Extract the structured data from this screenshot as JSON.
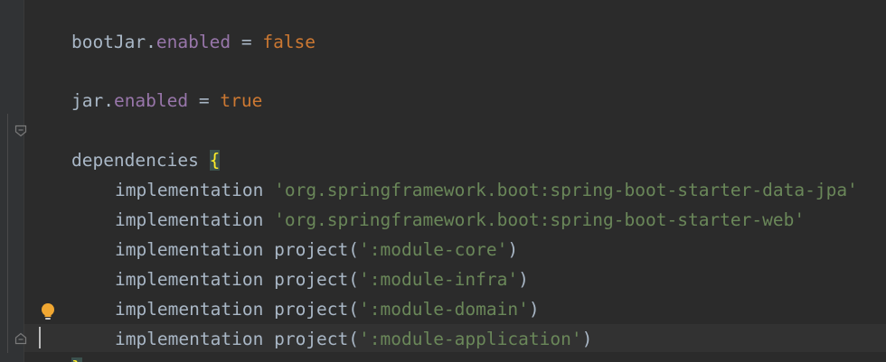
{
  "colors": {
    "background": "#2b2b2b",
    "gutter": "#313335",
    "default_text": "#a9b7c6",
    "property": "#9876aa",
    "keyword_literal": "#cc7832",
    "string": "#6a8759",
    "brace_highlight_bg": "#3b514d",
    "brace_highlight_fg": "#ffef28",
    "current_line": "#323232"
  },
  "lines": {
    "l1": {
      "obj": "bootJar",
      "dot": ".",
      "prop": "enabled",
      "eq": " = ",
      "val": "false"
    },
    "l2": {
      "obj": "jar",
      "dot": ".",
      "prop": "enabled",
      "eq": " = ",
      "val": "true"
    },
    "l3": {
      "keyword": "dependencies",
      "space": " ",
      "open_brace": "{"
    },
    "deps": [
      {
        "method": "implementation",
        "sep": " ",
        "arg": "'org.springframework.boot:spring-boot-starter-data-jpa'"
      },
      {
        "method": "implementation",
        "sep": " ",
        "arg": "'org.springframework.boot:spring-boot-starter-web'"
      },
      {
        "method": "implementation",
        "sep": " ",
        "call": "project(",
        "arg": "':module-core'",
        "close": ")"
      },
      {
        "method": "implementation",
        "sep": " ",
        "call": "project(",
        "arg": "':module-infra'",
        "close": ")"
      },
      {
        "method": "implementation",
        "sep": " ",
        "call": "project(",
        "arg": "':module-domain'",
        "close": ")"
      },
      {
        "method": "implementation",
        "sep": " ",
        "call": "project(",
        "arg": "':module-application'",
        "close": ")"
      }
    ],
    "close_brace": "}"
  },
  "icons": {
    "fold_open": "fold-open-icon",
    "fold_close": "fold-close-icon",
    "intention": "lightbulb-icon"
  }
}
